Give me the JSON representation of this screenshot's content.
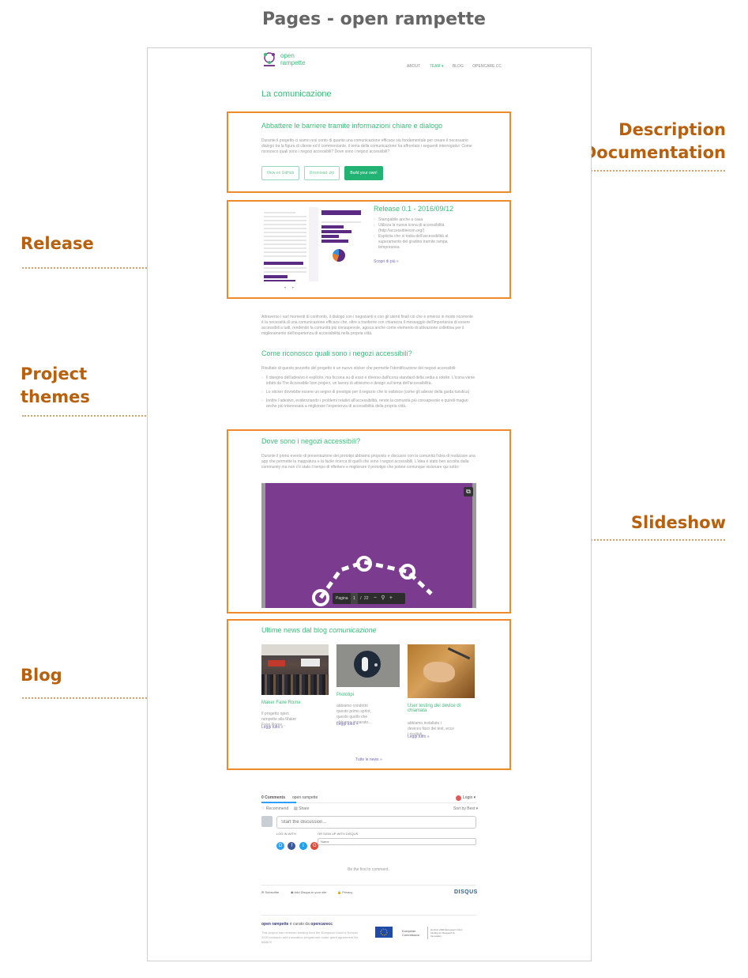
{
  "figure_title": "Pages - open rampette",
  "callouts": {
    "description": [
      "Description",
      "Documentation"
    ],
    "release": "Release",
    "themes": [
      "Project",
      "themes"
    ],
    "slideshow": "Slideshow",
    "blog": "Blog"
  },
  "site": {
    "logo_text": [
      "open",
      "rampette"
    ],
    "nav": [
      "ABOUT",
      "TEAM ▾",
      "BLOG",
      "OPENCARE.CC"
    ],
    "page_title": "La comunicazione"
  },
  "description": {
    "heading": "Abbattere le barriere tramite informazioni chiare e dialogo",
    "body": "Durante il progetto ci siamo resi conto di quanto una comunicazione efficace sia fondamentale per creare il necessario dialogo tra la figura di cliente ed il commerciante, il tema della comunicazione ha affrontato i seguenti interrogativi: Come riconosco quali sono i negozi accessibili? Dove sono i negozi accessibili?",
    "buttons": [
      "View on GitHub",
      "Download .zip",
      "Build your own!"
    ]
  },
  "release": {
    "title": "Release 0.1 - 2016/09/12",
    "items": [
      "Stampabile anche a casa",
      "Utilizza la nuova icona di accessibilità (http://accessibleicon.org/)",
      "Esplicita che si tratta dell'accessibilità al superamento del gradino tramite rampa temporanea"
    ],
    "more": "Scopri di più »",
    "dots": "• •"
  },
  "themes": {
    "intro": "Attraverso i vari momenti di confronto, il dialogo con i negozianti e con gli utenti finali ciò che è emerso in modo ricorrente è la necessità di una comunicazione efficace che, oltre a trasferire con chiarezza il messaggio dell'importanza di essere accessibili a tutti, rendendo la comunità più consapevole, agisca anche come elemento di attivazione collettiva per il miglioramento dell'esperienza di accessibilità nella propria città.",
    "heading": "Come riconosco quali sono i negozi accessibili?",
    "lead": "Risultato di questo pezzetto del progetto è un nuovo sticker che permette l'identificazione dei negozi accessibili:",
    "items": [
      "Il disegno dell'adesivo è esplicito, ma ficcona su di esso è diverso dall'icona standard della sedia a rotelle. L'icona viene infatti da The Accessible Icon project, un lavoro di attivismo e design sul tema dell'accessibilità.",
      "Lo sticker dovrebbe essere un segno di prestigio per il negozio che lo esibisce (come gli adesivi della guida turistica)",
      "Inoltre l'adesivo, evidenziando i problemi relativi all'accessibilità, rende la comunità più consapevole e quindi magari anche più interessata a migliorare l'esperienza di accessibilità della propria città."
    ]
  },
  "slideshow": {
    "heading": "Dove sono i negozi accessibili?",
    "body": "Durante il primo evento di presentazione dei prototipi abbiamo proposto e discusso con la comunità l'idea di realizzare una app che permette la mappatura e la facile ricerca di quelli che sono i negozi accessibili. L'idea è stato ben accolta dalla community ma non c'è stato il tempo di riflettere e migliorare il prototipo che potete comunque visionare qui sotto:",
    "toolbar_label": "Pagina",
    "page": "1",
    "sep": "/",
    "total": "22",
    "minus": "−",
    "plus": "+",
    "colors": {
      "slide": "#7b3b8e",
      "frame": "#9a9a9a"
    }
  },
  "blog": {
    "heading": "Ultime news dal blog",
    "heading_em": "comunicazione",
    "cards": [
      {
        "title": "Maker Faire Rome",
        "excerpt": "Il progetto open rampette alla Maker Faire Rome...",
        "link": "Leggi tutto »"
      },
      {
        "title": "Prototipi",
        "excerpt": "abbiamo condotto questo primo sprint, questo quello che abbiamo imparato...",
        "link": "Leggi tutto »"
      },
      {
        "title": "User testing dei device di chiamata",
        "excerpt": "abbiamo installato i devices fisici dei test, ecco i risultati...",
        "link": "Leggi tutto »"
      }
    ],
    "all_news": "Tutte le news »"
  },
  "comments": {
    "tab_count": "0 Comments",
    "tab_site": "open rampette",
    "login": "Login ▾",
    "recommend": "Recommend",
    "share": "Share",
    "sort": "Sort by Best ▾",
    "input_placeholder": "Start the discussion...",
    "log_in_with": "LOG IN WITH",
    "sign_up": "OR SIGN UP WITH DISQUS",
    "name_placeholder": "Name",
    "social": [
      "D",
      "f",
      "t",
      "G"
    ],
    "first": "Be the first to comment.",
    "subscribe": "Subscribe",
    "add_disqus": "Add Disqus to your site",
    "privacy": "Privacy",
    "brand": "DISQUS"
  },
  "footer": {
    "curated_a": "open rampette",
    "curated_b": "è curato da",
    "curated_c": "opencarecc",
    "fine": "This project has received funding from the European Union's Horizon 2020 research and innovation programme under grant agreement No 688670",
    "eu_label": "European Commission",
    "h2020": "Horizon 2020 European Union funding for Research & Innovation"
  }
}
